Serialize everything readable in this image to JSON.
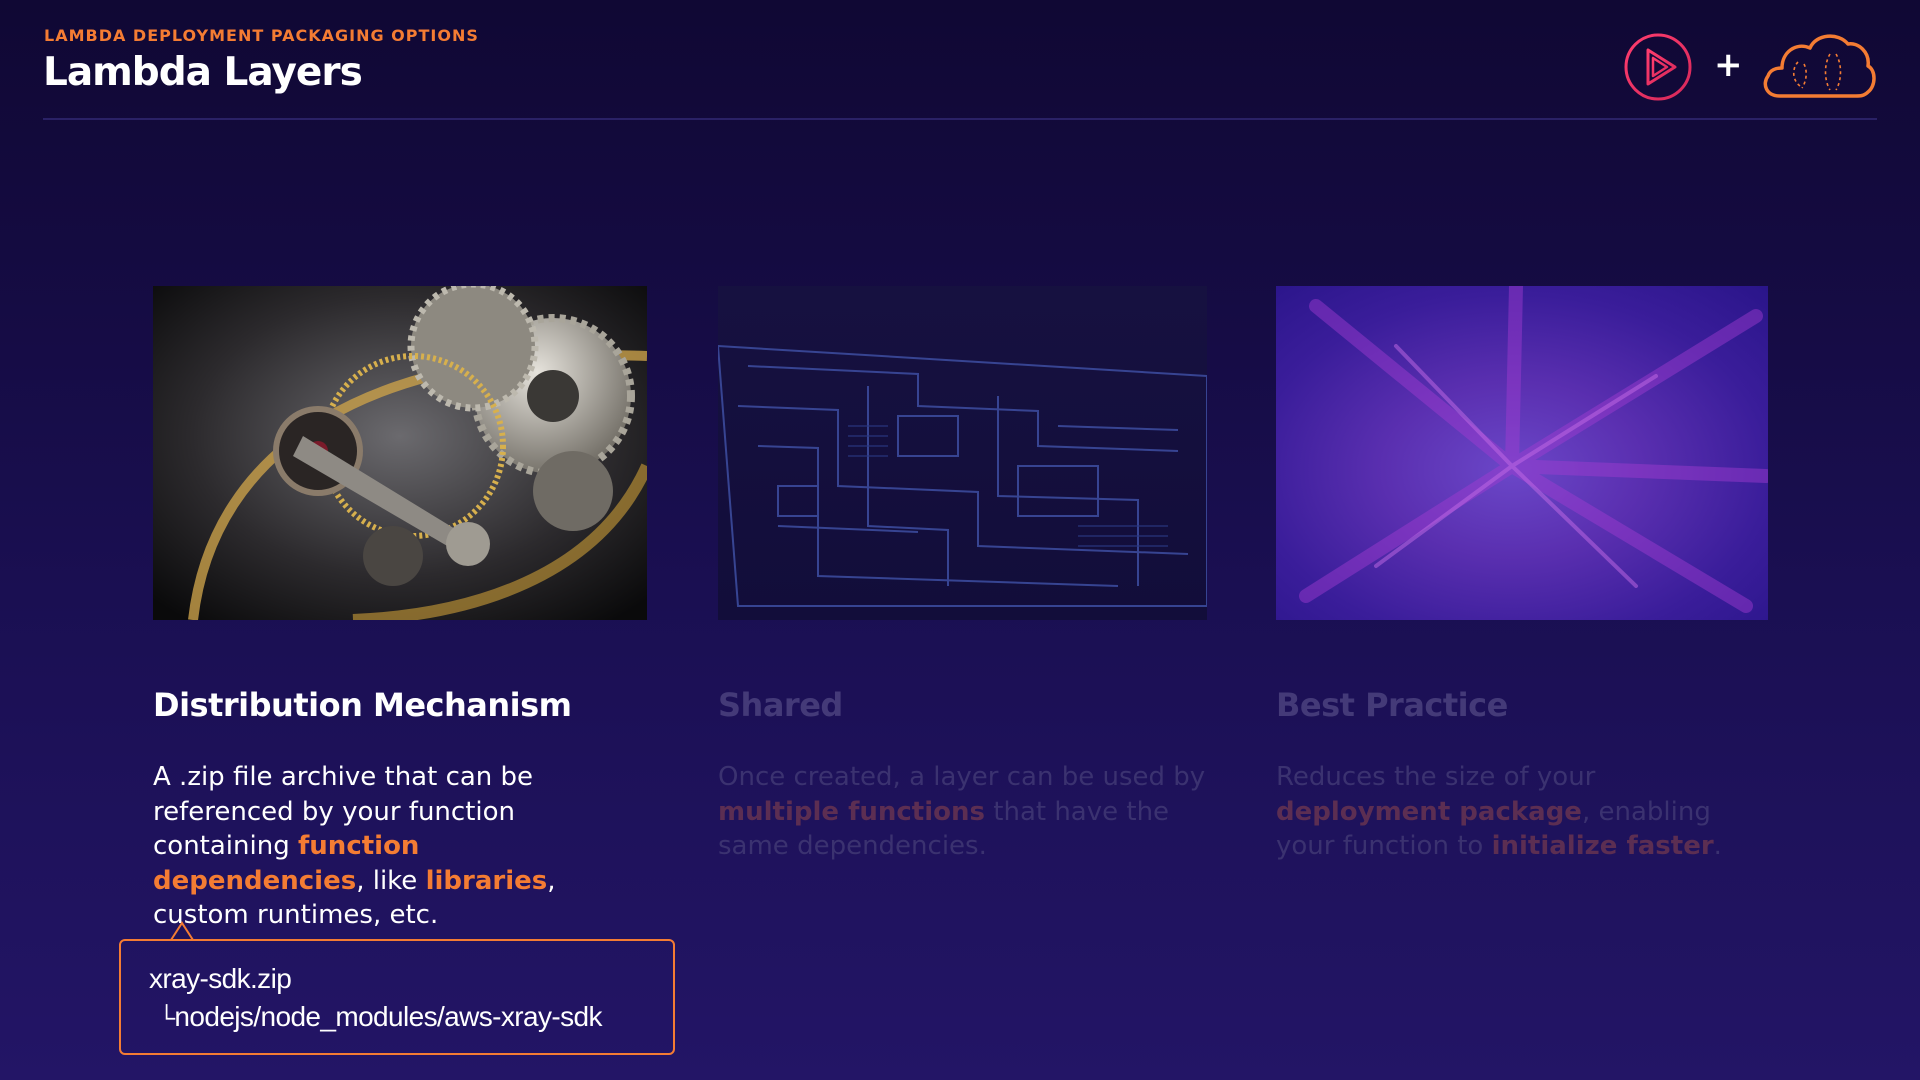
{
  "header": {
    "eyebrow": "LAMBDA DEPLOYMENT PACKAGING OPTIONS",
    "title": "Lambda Layers",
    "logos": {
      "plus": "+",
      "play_icon": "play-logo-icon",
      "cloud_icon": "cloud-logo-icon"
    }
  },
  "columns": [
    {
      "title": "Distribution Mechanism",
      "image": "clockwork-gears-icon",
      "active": true,
      "text": [
        {
          "t": "A .zip file archive that can be referenced by your function containing "
        },
        {
          "t": "function dependencies",
          "hl": true
        },
        {
          "t": ", like "
        },
        {
          "t": "libraries",
          "hl": true
        },
        {
          "t": ", custom runtimes, etc."
        }
      ]
    },
    {
      "title": "Shared",
      "image": "circuit-board-icon",
      "active": false,
      "text": [
        {
          "t": "Once created, a layer can be used by "
        },
        {
          "t": "multiple functions",
          "hl": true
        },
        {
          "t": " that have the same dependencies."
        }
      ]
    },
    {
      "title": "Best Practice",
      "image": "purple-radial-blur-icon",
      "active": false,
      "text": [
        {
          "t": "Reduces the size of your "
        },
        {
          "t": "deployment package",
          "hl": true
        },
        {
          "t": ", enabling your function to "
        },
        {
          "t": "initialize faster",
          "hl": true
        },
        {
          "t": "."
        }
      ]
    }
  ],
  "callout": {
    "file": "xray-sdk.zip",
    "tree_glyph": "└",
    "path": "nodejs/node_modules/aws-xray-sdk"
  },
  "colors": {
    "accent": "#f47c33",
    "background_top": "#100834",
    "background_bottom": "#231566",
    "dim_text": "#3b3270"
  }
}
